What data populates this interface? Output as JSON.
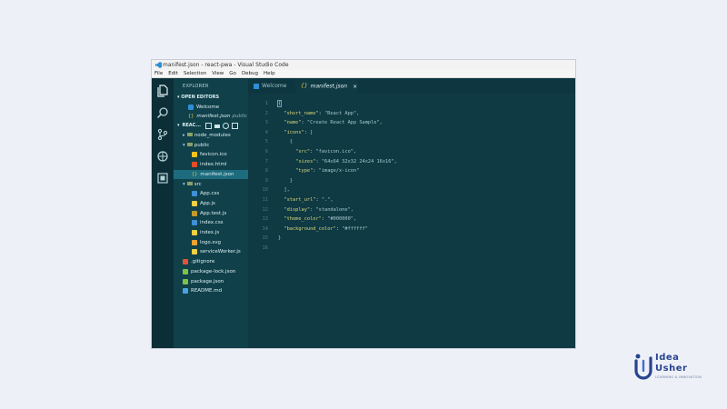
{
  "window": {
    "title": "manifest.json - react-pwa - Visual Studio Code",
    "menu": [
      "File",
      "Edit",
      "Selection",
      "View",
      "Go",
      "Debug",
      "Help"
    ]
  },
  "activity_bar": {
    "icons": [
      "files-icon",
      "search-icon",
      "source-control-icon",
      "debug-icon",
      "extensions-icon"
    ]
  },
  "sidebar": {
    "header": "EXPLORER",
    "open_editors_label": "OPEN EDITORS",
    "open_editors": [
      {
        "label": "Welcome",
        "icon": "vscode-icon"
      },
      {
        "label": "manifest.json",
        "desc": "public",
        "icon": "json-icon"
      }
    ],
    "project_label": "REAC...",
    "tree": [
      {
        "label": "node_modules",
        "icon": "folder-icon",
        "indent": 1
      },
      {
        "label": "public",
        "icon": "folder-open-icon",
        "indent": 1
      },
      {
        "label": "favicon.ico",
        "icon": "star-file-icon",
        "indent": 2
      },
      {
        "label": "index.html",
        "icon": "html-file-icon",
        "indent": 2
      },
      {
        "label": "manifest.json",
        "icon": "json-icon",
        "indent": 2,
        "selected": true
      },
      {
        "label": "src",
        "icon": "folder-open-icon",
        "indent": 1
      },
      {
        "label": "App.css",
        "icon": "css-file-icon",
        "indent": 2
      },
      {
        "label": "App.js",
        "icon": "js-file-icon",
        "indent": 2
      },
      {
        "label": "App.test.js",
        "icon": "test-file-icon",
        "indent": 2
      },
      {
        "label": "index.css",
        "icon": "css-file-icon",
        "indent": 2
      },
      {
        "label": "index.js",
        "icon": "js-file-icon",
        "indent": 2
      },
      {
        "label": "logo.svg",
        "icon": "svg-file-icon",
        "indent": 2
      },
      {
        "label": "serviceWorker.js",
        "icon": "js-file-icon",
        "indent": 2
      },
      {
        "label": ".gitignore",
        "icon": "git-file-icon",
        "indent": 1
      },
      {
        "label": "package-lock.json",
        "icon": "npm-file-icon",
        "indent": 1
      },
      {
        "label": "package.json",
        "icon": "npm-file-icon",
        "indent": 1
      },
      {
        "label": "README.md",
        "icon": "info-file-icon",
        "indent": 1
      }
    ]
  },
  "tabs": [
    {
      "label": "Welcome",
      "icon": "vscode-icon",
      "active": false
    },
    {
      "label": "manifest.json",
      "icon": "json-icon",
      "active": true,
      "close": "×"
    }
  ],
  "editor": {
    "line_numbers": [
      "1",
      "2",
      "3",
      "4",
      "5",
      "6",
      "7",
      "8",
      "9",
      "10",
      "11",
      "12",
      "13",
      "14",
      "15",
      "16"
    ],
    "lines": [
      "{",
      "  \"short_name\": \"React App\",",
      "  \"name\": \"Create React App Sample\",",
      "  \"icons\": [",
      "    {",
      "      \"src\": \"favicon.ico\",",
      "      \"sizes\": \"64x64 32x32 24x24 16x16\",",
      "      \"type\": \"image/x-icon\"",
      "    }",
      "  ],",
      "  \"start_url\": \".\",",
      "  \"display\": \"standalone\",",
      "  \"theme_color\": \"#000000\",",
      "  \"background_color\": \"#ffffff\"",
      "}",
      ""
    ]
  },
  "brand": {
    "name_line1": "Idea",
    "name_line2": "Usher",
    "tagline": "LEARNING & INNOVATION"
  },
  "colors": {
    "editor_bg": "#0f3a44",
    "sidebar_bg": "#10404a",
    "selection": "#1d6c7e",
    "brand": "#27448f"
  }
}
